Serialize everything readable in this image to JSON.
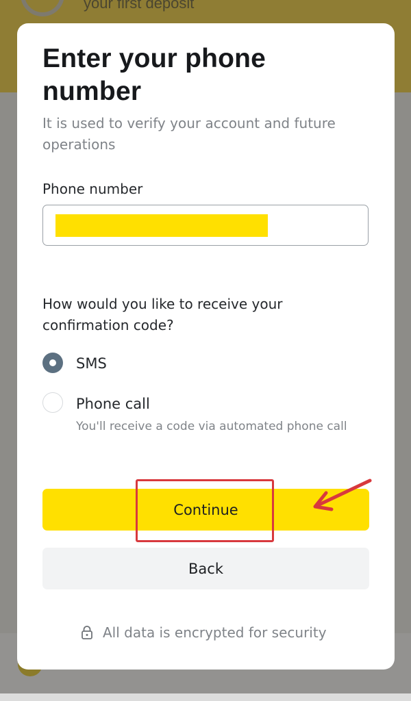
{
  "background": {
    "top_text": "your first deposit"
  },
  "modal": {
    "title": "Enter your phone number",
    "subtitle": "It is used to verify your account and future operations",
    "phone_field": {
      "label": "Phone number",
      "value": "",
      "value_redacted_color": "#ffe000"
    },
    "confirmation": {
      "question": "How would you like to receive your confirmation code?",
      "options": [
        {
          "label": "SMS",
          "selected": true
        },
        {
          "label": "Phone call",
          "selected": false,
          "hint": "You'll receive a code via automated phone call"
        }
      ]
    },
    "buttons": {
      "continue_label": "Continue",
      "back_label": "Back"
    },
    "security_note": "All data is encrypted for security",
    "icons": {
      "security": "lock-icon"
    }
  },
  "annotation": {
    "highlight_color": "#d8393d",
    "target": "Continue"
  },
  "colors": {
    "accent": "#ffe000",
    "radio_selected": "#5c7081",
    "secondary_button": "#f2f3f4"
  }
}
